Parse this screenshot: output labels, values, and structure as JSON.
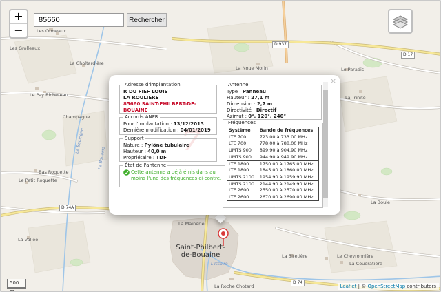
{
  "search": {
    "value": "85660",
    "button_label": "Rechercher"
  },
  "zoom": {
    "in_label": "+",
    "out_label": "−"
  },
  "map": {
    "place_labels": [
      "Les Ormeaux",
      "Les Grolleaux",
      "La Choltardière",
      "La Noue Morin",
      "Le Paradis",
      "Le Pay Richereau",
      "La Trinité",
      "Champagne",
      "Le Petit Roquette",
      "Bas Roquette",
      "La Vallée",
      "La Boule",
      "La Biretière",
      "Le Chevronnière",
      "La Couératière",
      "La Mainerie",
      "La Roche Chotard"
    ],
    "town_label": "Saint-Philbert-de-Bouaine",
    "river_labels": [
      "La Boulogne",
      "L'Issoire",
      "La Bouaine"
    ],
    "road_labels": [
      "D 937",
      "D 17",
      "D 74A",
      "D 74"
    ],
    "watermark": "7"
  },
  "popup": {
    "close_label": "×",
    "adresse": {
      "legend": "Adresse d'implantation",
      "line1": "R DU FIEF LOUIS",
      "line2": "LA ROULIÈRE",
      "line3": "85660 SAINT-PHILBERT-DE-",
      "line4": "BOUAINE"
    },
    "accords": {
      "legend": "Accords ANFR",
      "implantation_label": "Pour l'implantation : ",
      "implantation_value": "13/12/2013",
      "modification_label": "Dernière modification : ",
      "modification_value": "04/01/2019"
    },
    "support": {
      "legend": "Support",
      "nature_label": "Nature : ",
      "nature_value": "Pylône tubulaire",
      "hauteur_label": "Hauteur : ",
      "hauteur_value": "40,0 m",
      "proprietaire_label": "Propriétaire : ",
      "proprietaire_value": "TDF"
    },
    "etat": {
      "legend": "État de l'antenne",
      "line1": "Cette antenne a déjà émis dans au",
      "line2": "moins l'une des fréquences ci-contre."
    },
    "antenne": {
      "legend": "Antenne",
      "type_label": "Type : ",
      "type_value": "Panneau",
      "hauteur_label": "Hauteur : ",
      "hauteur_value": "27,1 m",
      "dimension_label": "Dimension : ",
      "dimension_value": "2,7 m",
      "directivite_label": "Directivité : ",
      "directivite_value": "Directif",
      "azimut_label": "Azimut : ",
      "azimut_value": "0°, 120°, 240°"
    },
    "frequences": {
      "legend": "Fréquences",
      "col_systeme": "Système",
      "col_bande": "Bande de fréquences",
      "rows": [
        [
          "LTE 700",
          "723.00 à 733.00 MHz"
        ],
        [
          "LTE 700",
          "778.00 à 788.00 MHz"
        ],
        [
          "UMTS 900",
          "899.90 à 904.90 MHz"
        ],
        [
          "UMTS 900",
          "944.90 à 949.90 MHz"
        ],
        [
          "LTE 1800",
          "1750.00 à 1765.00 MHz"
        ],
        [
          "LTE 1800",
          "1845.00 à 1860.00 MHz"
        ],
        [
          "UMTS 2100",
          "1954.90 à 1959.90 MHz"
        ],
        [
          "UMTS 2100",
          "2144.90 à 2149.90 MHz"
        ],
        [
          "LTE 2600",
          "2550.00 à 2570.00 MHz"
        ],
        [
          "LTE 2600",
          "2670.00 à 2690.00 MHz"
        ]
      ]
    }
  },
  "scale_label": "500 m",
  "attribution": {
    "leaflet": "Leaflet",
    "sep": " | © ",
    "osm": "OpenStreetMap",
    "rest": " contributors"
  },
  "colors": {
    "status_green": "#3fae2a",
    "address_red": "#c8102e",
    "marker_red": "#d83a3a"
  }
}
